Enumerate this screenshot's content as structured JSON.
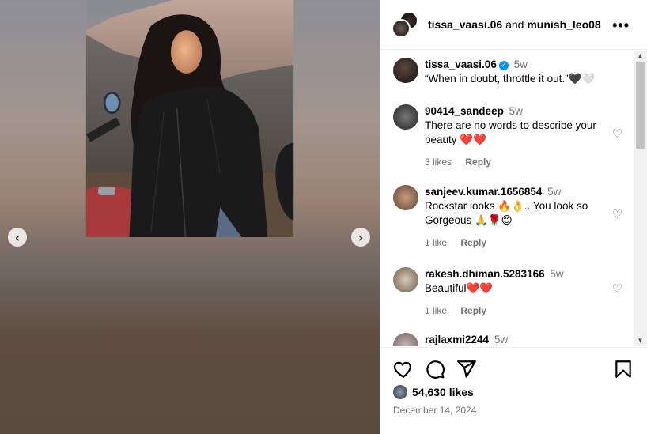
{
  "post": {
    "carousel": {
      "prev_icon": "chevron-left-icon",
      "next_icon": "chevron-right-icon",
      "prev_symbol": "‹",
      "next_symbol": "›"
    },
    "header": {
      "user1": "tissa_vaasi.06",
      "joiner": "and",
      "user2": "munish_leo08",
      "more_symbol": "•••"
    },
    "caption": {
      "username": "tissa_vaasi.06",
      "time": "5w",
      "text": "“When in doubt, throttle it out.”🖤🤍"
    },
    "comments": [
      {
        "username": "90414_sandeep",
        "time": "5w",
        "text": "There are no words to describe your beauty ❤️❤️",
        "likes": "3 likes",
        "reply": "Reply"
      },
      {
        "username": "sanjeev.kumar.1656854",
        "time": "5w",
        "text": "Rockstar looks 🔥👌.. You look so Gorgeous 🙏🌹😊",
        "likes": "1 like",
        "reply": "Reply"
      },
      {
        "username": "rakesh.dhiman.5283166",
        "time": "5w",
        "text": "Beautiful❤️❤️",
        "likes": "1 like",
        "reply": "Reply"
      },
      {
        "username": "rajlaxmi2244",
        "time": "5w",
        "text": "",
        "likes": "",
        "reply": ""
      }
    ],
    "likes_count": "54,630 likes",
    "date": "December 14, 2024",
    "colors": {
      "verified": "#0095f6",
      "muted": "#737373",
      "border": "#dbdbdb"
    }
  }
}
